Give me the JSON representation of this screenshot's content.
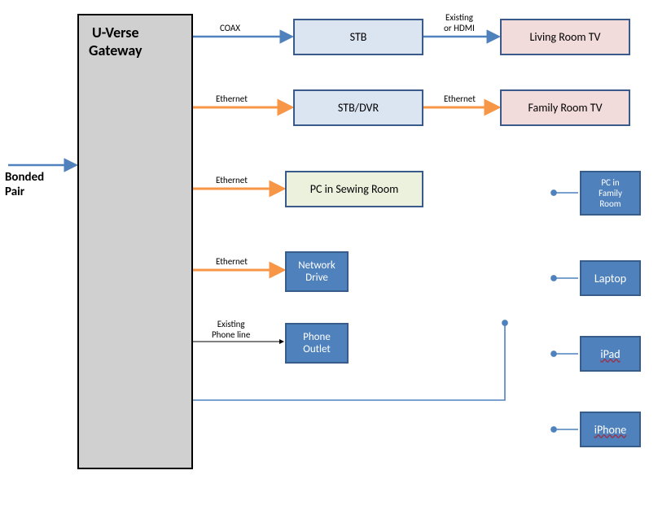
{
  "gateway": {
    "label": "U-Verse\nGateway"
  },
  "bonded": {
    "label": "Bonded\nPair"
  },
  "row1": {
    "conn1": "COAX",
    "stb": "STB",
    "conn2": "Existing\nor HDMI",
    "tv": "Living Room TV"
  },
  "row2": {
    "conn1": "Ethernet",
    "stb": "STB/DVR",
    "conn2": "Ethernet",
    "tv": "Family Room TV"
  },
  "row3": {
    "conn1": "Ethernet",
    "pc": "PC in Sewing Room"
  },
  "row4": {
    "conn1": "Ethernet",
    "dev": "Network\nDrive"
  },
  "row5": {
    "conn1": "Existing\nPhone line",
    "dev": "Phone\nOutlet"
  },
  "side": {
    "pcfamily": "PC in\nFamily\nRoom",
    "laptop": "Laptop",
    "ipad": "iPad",
    "iphone": "iPhone"
  },
  "colors": {
    "blueArrow": "#4f81bd",
    "orangeArrow": "#f79646",
    "thinArrow": "#000"
  }
}
